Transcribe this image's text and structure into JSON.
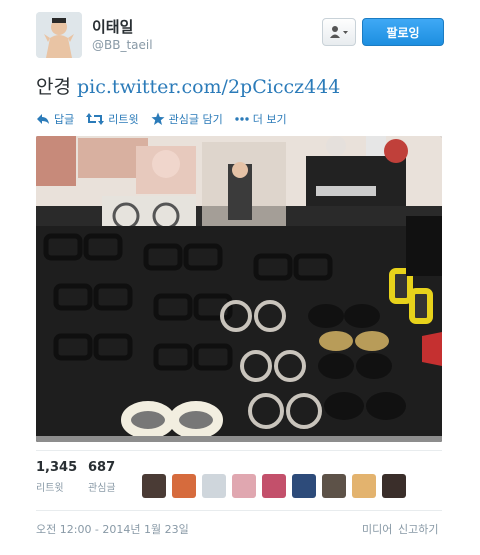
{
  "user": {
    "display_name": "이태일",
    "screen_name": "@BB_taeil",
    "follow_label": "팔로잉"
  },
  "tweet": {
    "text": "안경",
    "link": "pic.twitter.com/2pCiccz444"
  },
  "actions": {
    "reply": "답글",
    "retweet": "리트윗",
    "favorite": "관심글 담기",
    "more": "더 보기"
  },
  "stats": {
    "retweets": "1,345",
    "retweets_label": "리트윗",
    "favorites": "687",
    "favorites_label": "관심글"
  },
  "footer": {
    "timestamp": "오전 12:00 - 2014년 1월 23일",
    "media": "미디어",
    "report": "신고하기"
  },
  "colors": {
    "link": "#2b7bb9",
    "follow_button": "#1d8fe0",
    "muted": "#8899a6"
  },
  "icons": [
    "user-dropdown-icon",
    "reply-icon",
    "retweet-icon",
    "star-icon",
    "more-dots-icon"
  ]
}
